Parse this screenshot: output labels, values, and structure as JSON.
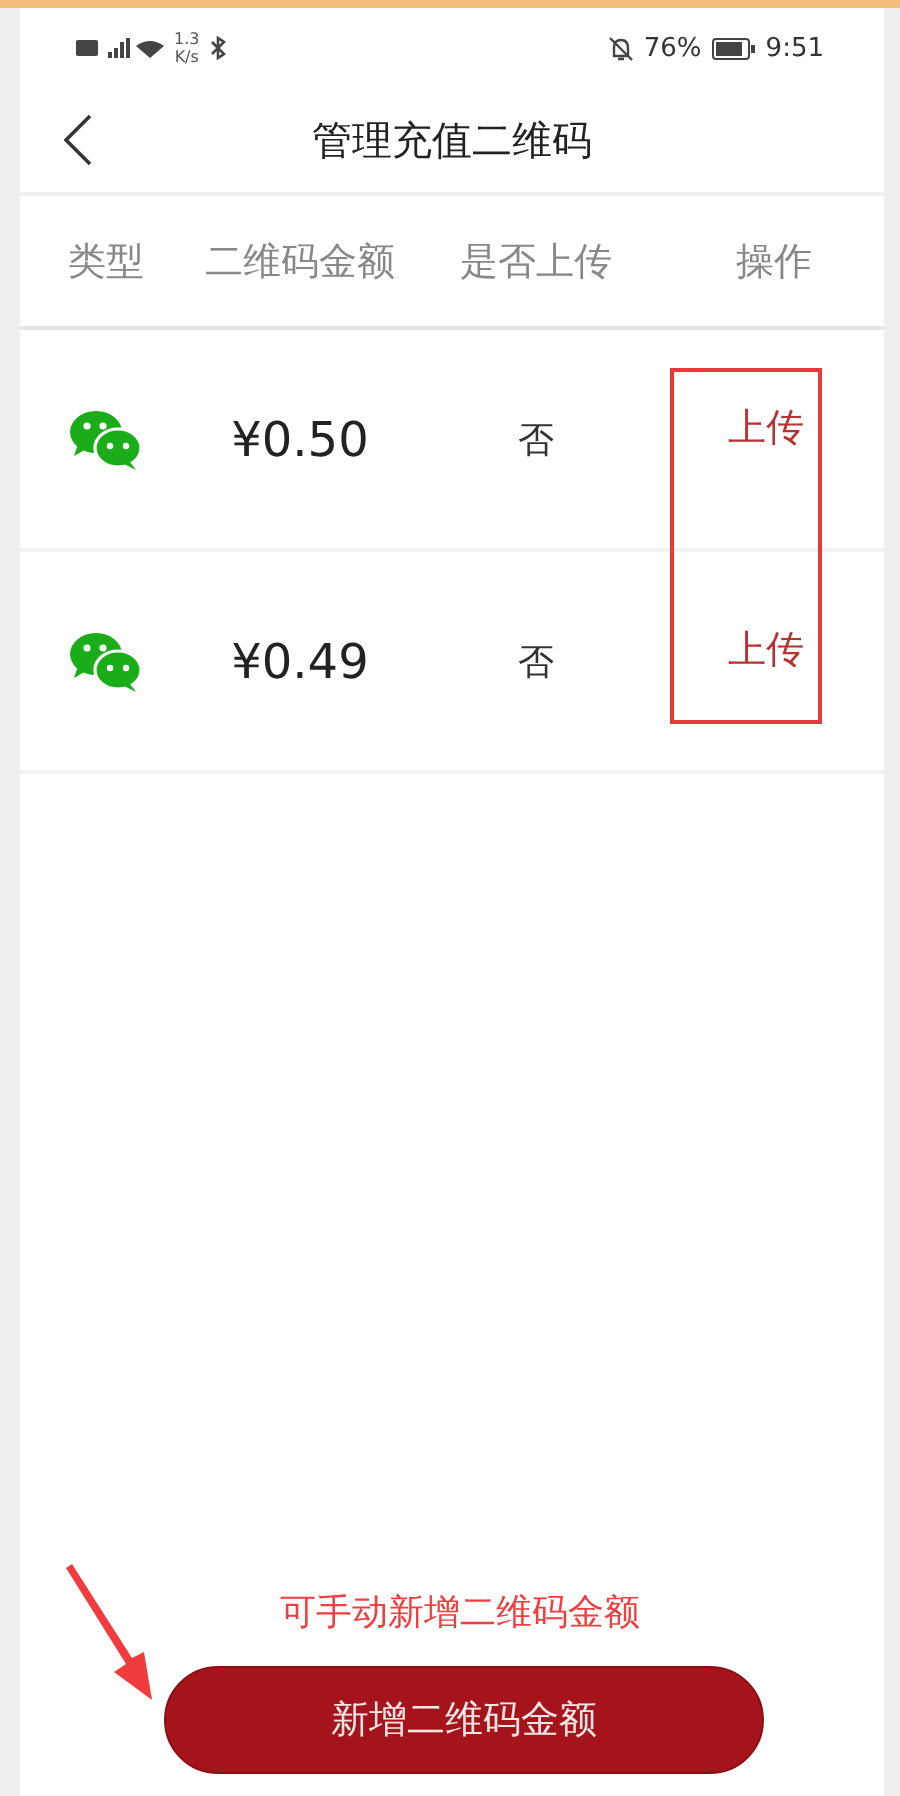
{
  "status_bar": {
    "speed": "1.3",
    "speed_unit": "K/s",
    "battery": "76%",
    "time": "9:51"
  },
  "header": {
    "title": "管理充值二维码"
  },
  "table": {
    "columns": [
      "类型",
      "二维码金额",
      "是否上传",
      "操作"
    ],
    "rows": [
      {
        "kind": "wechat",
        "amount": "¥0.50",
        "uploaded": "否",
        "action": "上传"
      },
      {
        "kind": "wechat",
        "amount": "¥0.49",
        "uploaded": "否",
        "action": "上传"
      }
    ]
  },
  "annotation": {
    "text": "可手动新增二维码金额"
  },
  "add_button": {
    "label": "新增二维码金额"
  }
}
